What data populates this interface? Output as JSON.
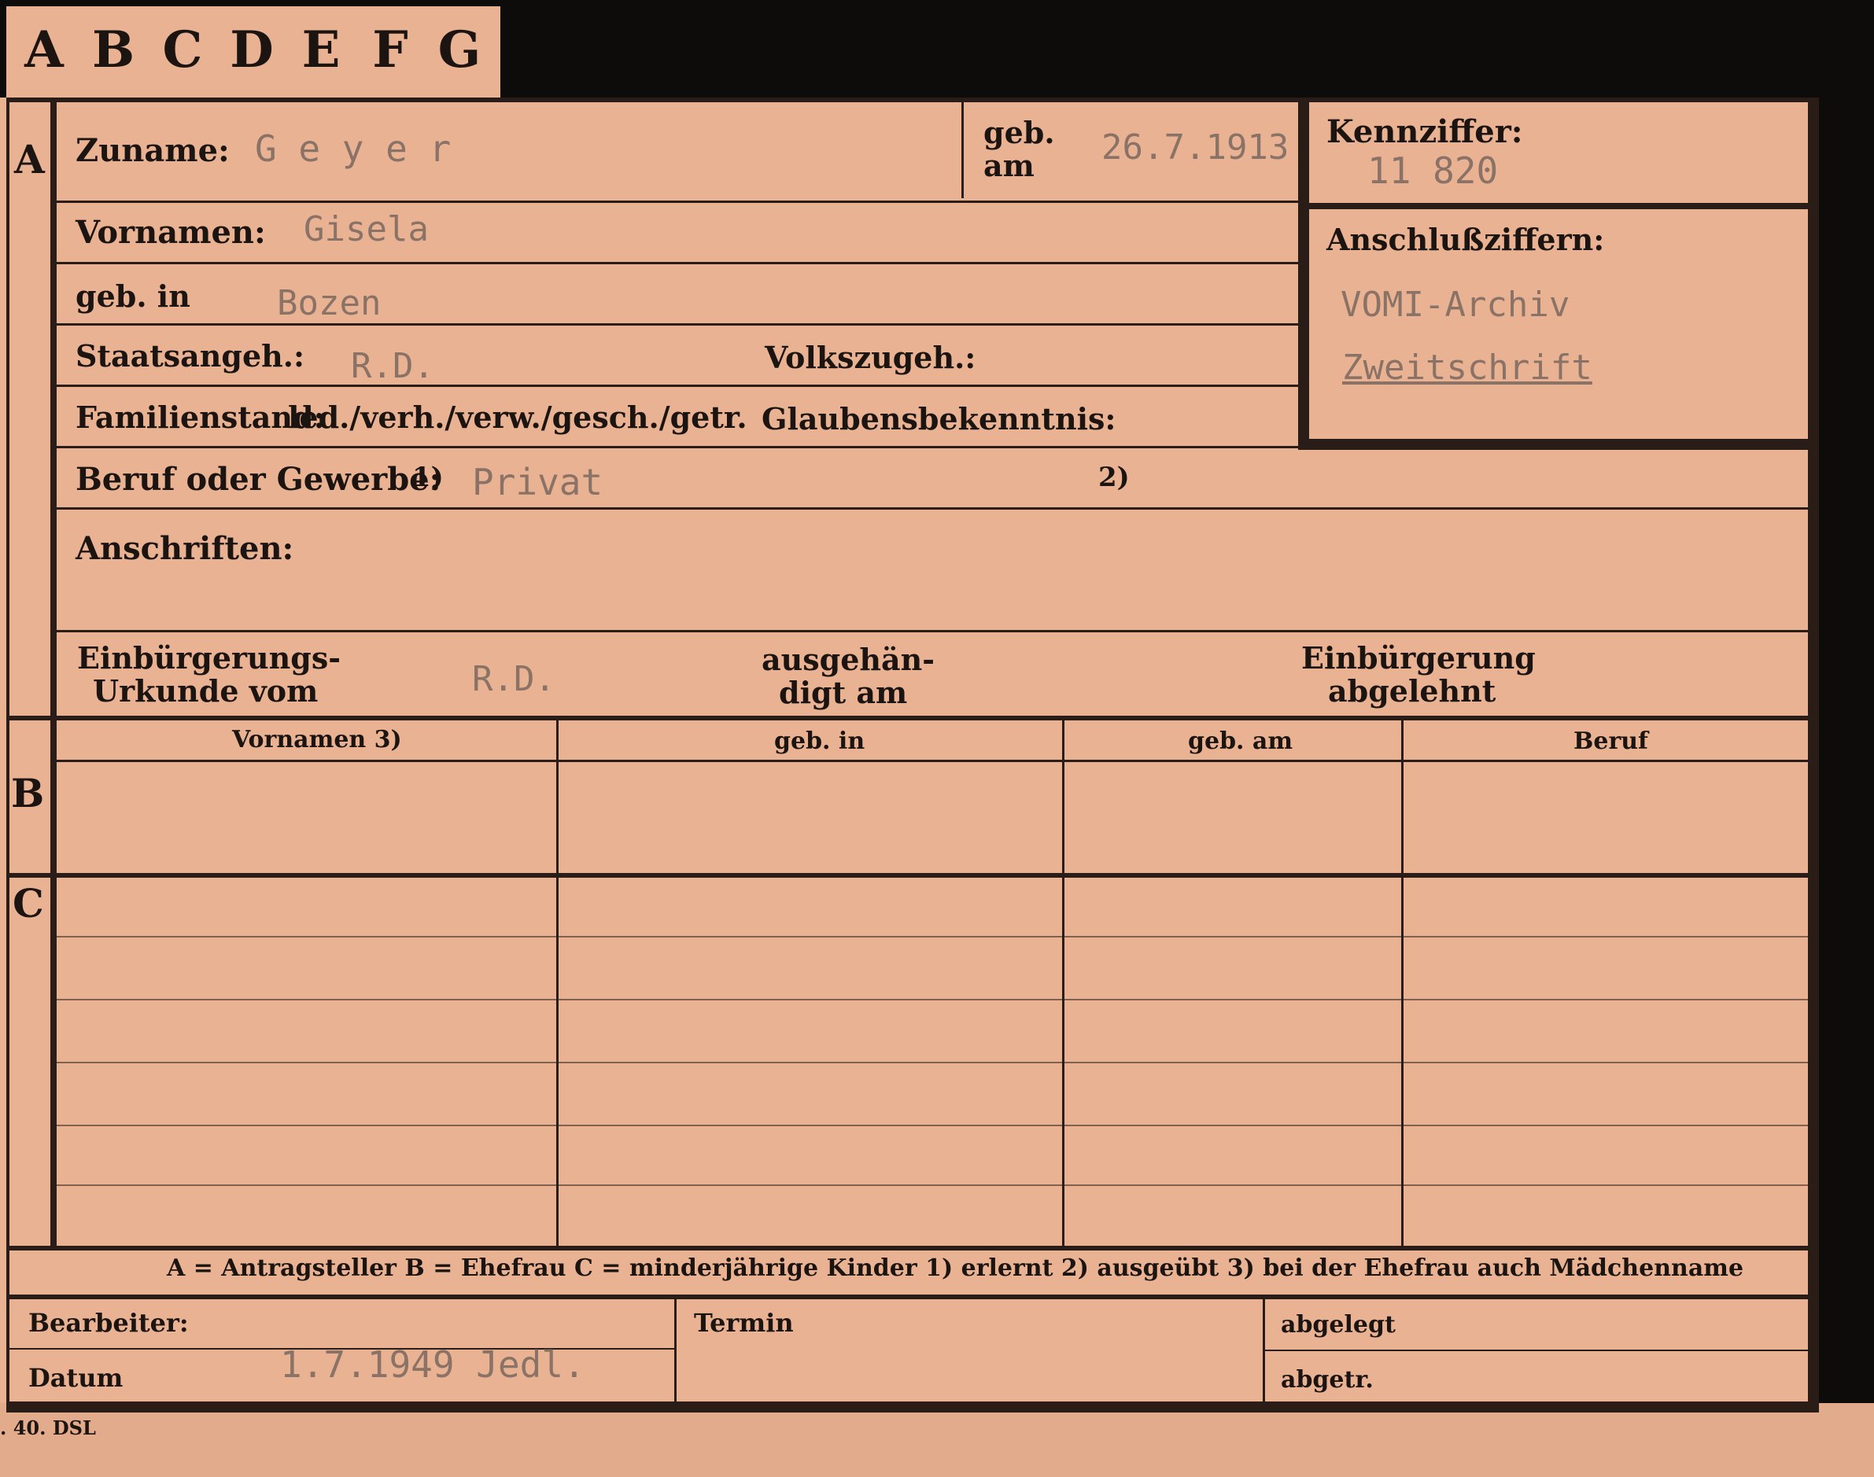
{
  "tabs": [
    "A",
    "B",
    "C",
    "D",
    "E",
    "F",
    "G"
  ],
  "sections": {
    "a": "A",
    "b": "B",
    "c": "C"
  },
  "section_a": {
    "zuname_label": "Zuname:",
    "zuname_value": "G e y e r",
    "geb_am_label_1": "geb.",
    "geb_am_label_2": "am",
    "geb_am_value": "26.7.1913",
    "kennziffer_label": "Kennziffer:",
    "kennziffer_value": "11 820",
    "vornamen_label": "Vornamen:",
    "vornamen_value": "Gisela",
    "geb_in_label": "geb. in",
    "geb_in_value": "Bozen",
    "anschluss_label": "Anschlußziffern:",
    "anschluss_value_1": "VOMI-Archiv",
    "anschluss_value_2": "Zweitschrift",
    "staatsangeh_label": "Staatsangeh.:",
    "staatsangeh_value": "R.D.",
    "volkszugeh_label": "Volkszugeh.:",
    "familienstand_label": "Familienstand:",
    "familienstand_options": "led./verh./verw./gesch./getr.",
    "glauben_label": "Glaubensbekenntnis:",
    "beruf_label": "Beruf oder Gewerbe:",
    "beruf_note_1": "1)",
    "beruf_value": "Privat",
    "beruf_note_2": "2)",
    "anschriften_label": "Anschriften:",
    "einb_urkunde_label_1": "Einbürgerungs-",
    "einb_urkunde_label_2": "Urkunde vom",
    "einb_urkunde_value": "R.D.",
    "ausgehaendigt_label_1": "ausgehän-",
    "ausgehaendigt_label_2": "digt am",
    "einb_abgelehnt_label_1": "Einbürgerung",
    "einb_abgelehnt_label_2": "abgelehnt"
  },
  "table_headers": [
    "Vornamen 3)",
    "geb. in",
    "geb. am",
    "Beruf"
  ],
  "legend": "A = Antragsteller   B = Ehefrau   C = minderjährige Kinder   1) erlernt   2) ausgeübt   3) bei der Ehefrau auch Mädchenname",
  "footer": {
    "bearbeiter_label": "Bearbeiter:",
    "datum_label": "Datum",
    "datum_value": "1.7.1949 Jedl.",
    "termin_label": "Termin",
    "abgelegt_label": "abgelegt",
    "abgetr_label": "abgetr."
  },
  "print_mark": ". 40. DSL",
  "colors": {
    "paper": "#e9b393",
    "ink": "#1c1410",
    "typed": "#8a7266",
    "background": "#0e0c0a"
  }
}
